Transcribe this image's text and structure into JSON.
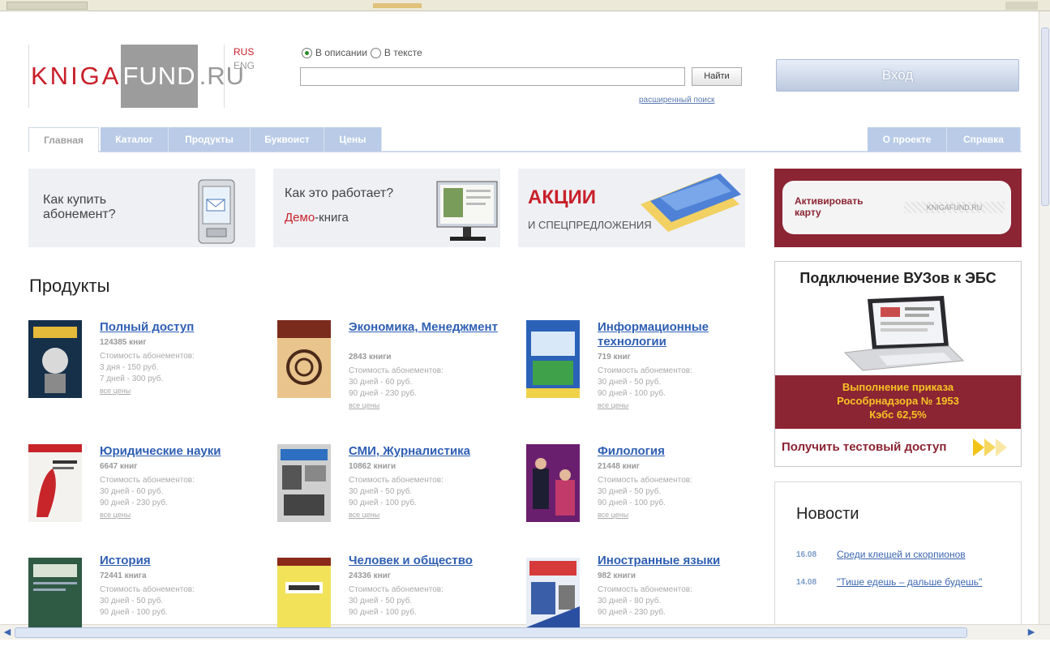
{
  "header": {
    "logo_left": "KNIGA",
    "logo_mid": "FUND",
    "logo_right": ".RU",
    "lang_rus": "RUS",
    "lang_eng": "ENG",
    "radio_desc": "В описании",
    "radio_text": "В тексте",
    "search_placeholder": "",
    "search_button": "Найти",
    "advanced_search": "расширенный поиск",
    "login_button": "Вход"
  },
  "nav": {
    "left_tabs": [
      "Главная",
      "Каталог",
      "Продукты",
      "Буквоист",
      "Цены"
    ],
    "right_tabs": [
      "О проекте",
      "Справка"
    ]
  },
  "promos": {
    "buy_title": "Как купить абонемент?",
    "demo_title": "Как это работает?",
    "demo_sub_red": "Демо",
    "demo_sub_rest": "-книга",
    "sales_title": "АКЦИИ",
    "sales_sub": "И СПЕЦПРЕДЛОЖЕНИЯ",
    "activate": "Активировать карту",
    "activate_logo": "KNIGAFUND.RU"
  },
  "ebs": {
    "title": "Подключение ВУЗов к ЭБС",
    "line1": "Выполнение приказа",
    "line2": "Рособрнадзора № 1953",
    "line3": "Кэбс 62,5%",
    "cta": "Получить тестовый доступ"
  },
  "news": {
    "heading": "Новости",
    "items": [
      {
        "date": "16.08",
        "text": "Среди клещей и скорпионов"
      },
      {
        "date": "14.08",
        "text": "\"Тише едешь – дальше будешь\""
      }
    ]
  },
  "products": {
    "heading": "Продукты",
    "price_label": "Стоимость абонементов:",
    "all_prices": "все цены",
    "items": [
      {
        "title": "Полный доступ",
        "count": "124385 книг",
        "p1": "3 дня - 150 руб.",
        "p2": "7 дней - 300 руб."
      },
      {
        "title": "Экономика, Менеджмент",
        "count": "2843 книги",
        "p1": "30 дней - 60 руб.",
        "p2": "90 дней - 230 руб."
      },
      {
        "title": "Информационные технологии",
        "count": "719 книг",
        "p1": "30 дней - 50 руб.",
        "p2": "90 дней - 100 руб."
      },
      {
        "title": "Юридические науки",
        "count": "6647 книг",
        "p1": "30 дней - 60 руб.",
        "p2": "90 дней - 230 руб."
      },
      {
        "title": "СМИ, Журналистика",
        "count": "10862 книги",
        "p1": "30 дней - 50 руб.",
        "p2": "90 дней - 100 руб."
      },
      {
        "title": "Филология",
        "count": "21448 книг",
        "p1": "30 дней - 50 руб.",
        "p2": "90 дней - 100 руб."
      },
      {
        "title": "История",
        "count": "72441 книга",
        "p1": "30 дней - 50 руб.",
        "p2": "90 дней - 100 руб."
      },
      {
        "title": "Человек и общество",
        "count": "24336 книг",
        "p1": "30 дней - 50 руб.",
        "p2": "90 дней - 100 руб."
      },
      {
        "title": "Иностранные языки",
        "count": "982 книги",
        "p1": "30 дней - 80 руб.",
        "p2": "90 дней - 230 руб."
      }
    ]
  },
  "icons": {
    "scroll_left": "◀",
    "scroll_right": "▶"
  }
}
